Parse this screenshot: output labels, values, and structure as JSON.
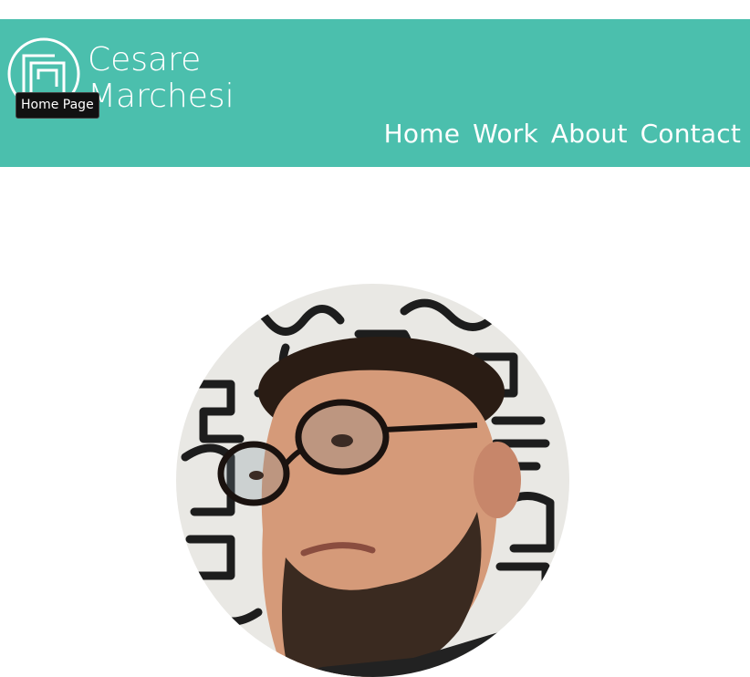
{
  "header": {
    "brand_color": "#4bbfad",
    "logo": {
      "name_line1": "Cesare",
      "name_line2": "Marchesi"
    },
    "tooltip": "Home Page",
    "nav": [
      {
        "label": "Home"
      },
      {
        "label": "Work"
      },
      {
        "label": "About"
      },
      {
        "label": "Contact"
      }
    ]
  },
  "portrait": {
    "icon": "profile-photo"
  }
}
